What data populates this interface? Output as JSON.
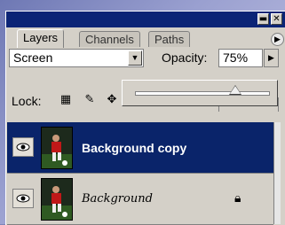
{
  "palette": {
    "tabs": [
      {
        "label": "Layers"
      },
      {
        "label": "Channels"
      },
      {
        "label": "Paths"
      }
    ],
    "blend_mode": "Screen",
    "opacity_label": "Opacity:",
    "opacity_value": "75%",
    "opacity_slider_fraction": 0.75,
    "lock_label": "Lock:",
    "layers": [
      {
        "name": "Background copy",
        "selected": true,
        "locked": false
      },
      {
        "name": "Background",
        "selected": false,
        "locked": true
      }
    ]
  },
  "icons": [
    "minimize-icon",
    "close-icon",
    "palette-menu-icon",
    "dropdown-arrow-icon",
    "slider-arrow-icon",
    "lock-transparency-icon",
    "lock-brush-icon",
    "lock-move-icon",
    "eye-icon",
    "lock-icon"
  ],
  "colors": {
    "titlebar": "#0b2476",
    "selected_row": "#0a246a",
    "panel": "#d4d0c8"
  }
}
